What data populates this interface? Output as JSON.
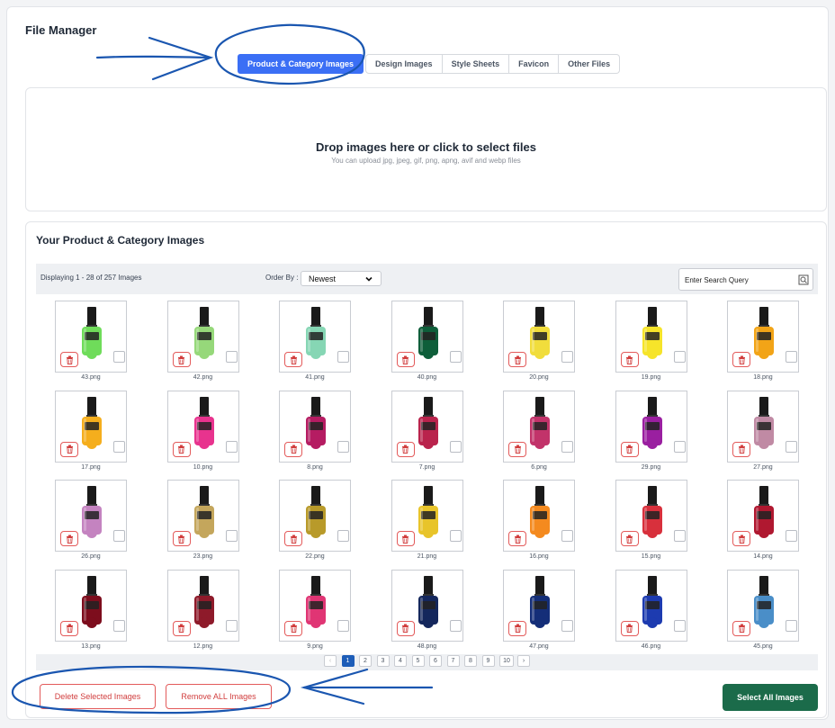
{
  "page": {
    "title": "File Manager"
  },
  "tabs": [
    {
      "label": "Product & Category Images",
      "active": true
    },
    {
      "label": "Design Images",
      "active": false
    },
    {
      "label": "Style Sheets",
      "active": false
    },
    {
      "label": "Favicon",
      "active": false
    },
    {
      "label": "Other Files",
      "active": false
    }
  ],
  "dropzone": {
    "title": "Drop images here or click to select files",
    "subtitle": "You can upload jpg, jpeg, gif, png, apng, avif and webp files"
  },
  "gallery": {
    "title": "Your Product & Category Images",
    "displaying": "Displaying 1 - 28 of 257 Images",
    "order_label": "Order By :",
    "order_value": "Newest",
    "search_placeholder": "Enter Search Query"
  },
  "images": [
    {
      "name": "43.png",
      "color": "#6fdc5a"
    },
    {
      "name": "42.png",
      "color": "#96d87a"
    },
    {
      "name": "41.png",
      "color": "#86d6b4"
    },
    {
      "name": "40.png",
      "color": "#0e5e3a"
    },
    {
      "name": "20.png",
      "color": "#f1dd3c"
    },
    {
      "name": "19.png",
      "color": "#f6e42a"
    },
    {
      "name": "18.png",
      "color": "#f2a417"
    },
    {
      "name": "17.png",
      "color": "#f5ae1d"
    },
    {
      "name": "10.png",
      "color": "#e8338e"
    },
    {
      "name": "8.png",
      "color": "#b51c62"
    },
    {
      "name": "7.png",
      "color": "#b9234c"
    },
    {
      "name": "6.png",
      "color": "#c2336a"
    },
    {
      "name": "29.png",
      "color": "#9a1fa0"
    },
    {
      "name": "27.png",
      "color": "#c08aa4"
    },
    {
      "name": "26.png",
      "color": "#c483c0"
    },
    {
      "name": "23.png",
      "color": "#c4a65c"
    },
    {
      "name": "22.png",
      "color": "#b89a2a"
    },
    {
      "name": "21.png",
      "color": "#e8c42a"
    },
    {
      "name": "16.png",
      "color": "#f48a1f"
    },
    {
      "name": "15.png",
      "color": "#d8303c"
    },
    {
      "name": "14.png",
      "color": "#b01830"
    },
    {
      "name": "13.png",
      "color": "#7d0d1d"
    },
    {
      "name": "12.png",
      "color": "#8e1a2a"
    },
    {
      "name": "9.png",
      "color": "#e03574"
    },
    {
      "name": "48.png",
      "color": "#14275c"
    },
    {
      "name": "47.png",
      "color": "#142e78"
    },
    {
      "name": "46.png",
      "color": "#1d3bb0"
    },
    {
      "name": "45.png",
      "color": "#4a8ec8"
    }
  ],
  "pagination": {
    "prev": "‹",
    "pages": [
      "1",
      "2",
      "3",
      "4",
      "5",
      "6",
      "7",
      "8",
      "9",
      "10"
    ],
    "current": "1",
    "next": "›"
  },
  "actions": {
    "delete_selected": "Delete Selected Images",
    "remove_all": "Remove ALL Images",
    "select_all": "Select All Images"
  },
  "colors": {
    "accent": "#3b6ff5",
    "danger": "#e35a5a",
    "success": "#1b6b4a",
    "annotation": "#1a56b0"
  },
  "icons": {
    "delete": "trash-icon",
    "search": "search-icon",
    "dropdown": "chevron-down-icon",
    "annotation": "arrow-annotation"
  }
}
